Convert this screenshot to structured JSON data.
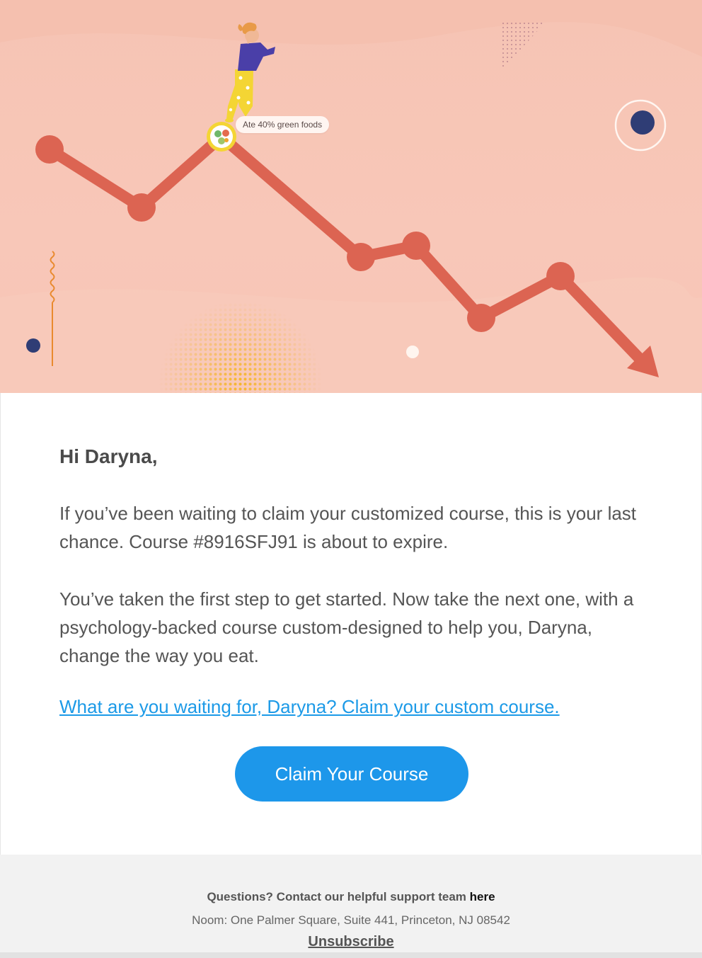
{
  "hero": {
    "badge_label": "Ate 40% green foods",
    "chart_color": "#dc6452",
    "navy_color": "#2f3d75",
    "figure_top_color": "#4a3fa8",
    "figure_pants_color": "#f4d534"
  },
  "body": {
    "greeting": "Hi Daryna,",
    "paragraph1": "If you’ve been waiting to claim your customized course, this is your last chance. Course #8916SFJ91 is about to expire.",
    "paragraph2": "You’ve taken the first step to get started. Now take the next one, with a psychology-backed course custom-designed to help you, Daryna, change the way you eat.",
    "link_text": "What are you waiting for, Daryna? Claim your custom course.",
    "button_label": "Claim Your Course",
    "accent_color": "#1d97ea"
  },
  "footer": {
    "questions_text": "Questions? Contact our helpful support team ",
    "questions_link": "here",
    "address": "Noom: One Palmer Square, Suite 441, Princeton, NJ 08542",
    "unsubscribe": "Unsubscribe"
  }
}
